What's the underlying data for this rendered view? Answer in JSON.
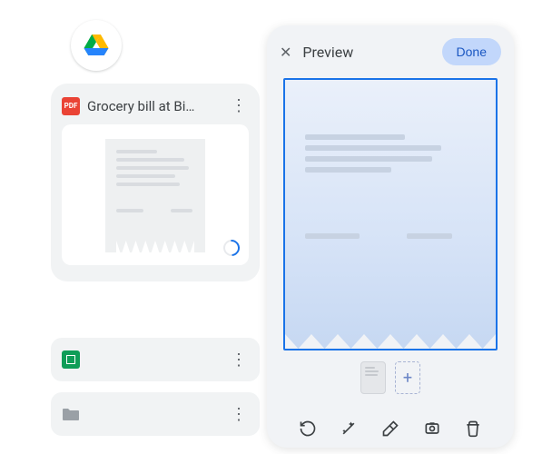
{
  "drive_logo": "google-drive",
  "file_card": {
    "badge_text": "PDF",
    "title": "Grocery bill at Bi…",
    "more_label": "⋮",
    "loading": true
  },
  "rows": [
    {
      "type": "sheets",
      "more_label": "⋮"
    },
    {
      "type": "folder",
      "more_label": "⋮"
    }
  ],
  "preview": {
    "title": "Preview",
    "done_label": "Done",
    "close_label": "✕",
    "add_page_label": "+"
  },
  "tools": {
    "retake": "retake",
    "auto_enhance": "auto-enhance",
    "erase": "erase",
    "crop": "crop",
    "delete": "delete"
  }
}
